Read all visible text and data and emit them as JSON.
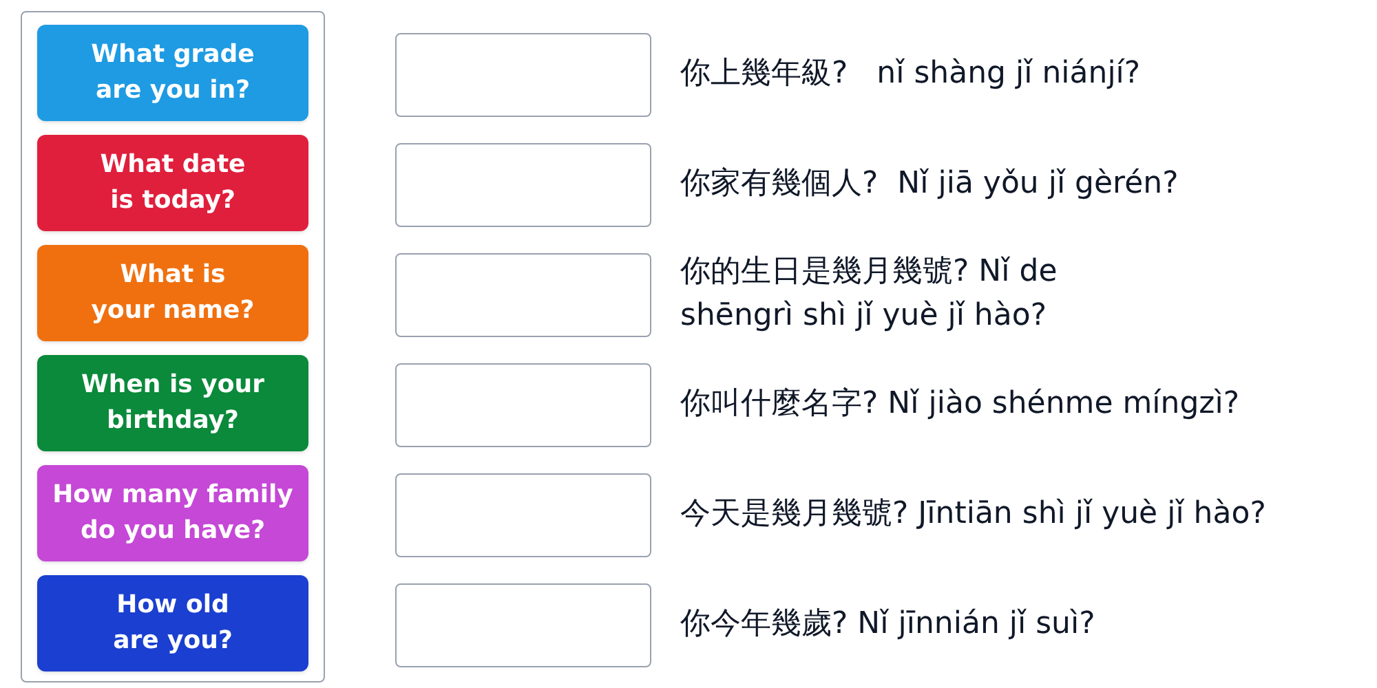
{
  "cards": [
    {
      "lines": [
        "What grade",
        "are you in?"
      ],
      "color": "#1e9be3"
    },
    {
      "lines": [
        "What date",
        "is today?"
      ],
      "color": "#e01f3d"
    },
    {
      "lines": [
        "What is",
        "your name?"
      ],
      "color": "#f07010"
    },
    {
      "lines": [
        "When is your",
        "birthday?"
      ],
      "color": "#0a8a3a"
    },
    {
      "lines": [
        "How many family",
        "do you have?"
      ],
      "color": "#c548d6"
    },
    {
      "lines": [
        "How old",
        "are you?"
      ],
      "color": "#1b3fd0"
    }
  ],
  "prompts": [
    {
      "lines": [
        "你上幾年級?   nǐ shàng jǐ niánjí?"
      ]
    },
    {
      "lines": [
        "你家有幾個人?  Nǐ jiā yǒu jǐ gèrén?"
      ]
    },
    {
      "lines": [
        "你的生日是幾月幾號? Nǐ de",
        "shēngrì shì jǐ yuè jǐ hào?"
      ]
    },
    {
      "lines": [
        "你叫什麼名字? Nǐ jiào shénme míngzì?"
      ]
    },
    {
      "lines": [
        "今天是幾月幾號? Jīntiān shì jǐ yuè jǐ hào?"
      ]
    },
    {
      "lines": [
        "你今年幾歲? Nǐ jīnnián jǐ suì?"
      ]
    }
  ]
}
